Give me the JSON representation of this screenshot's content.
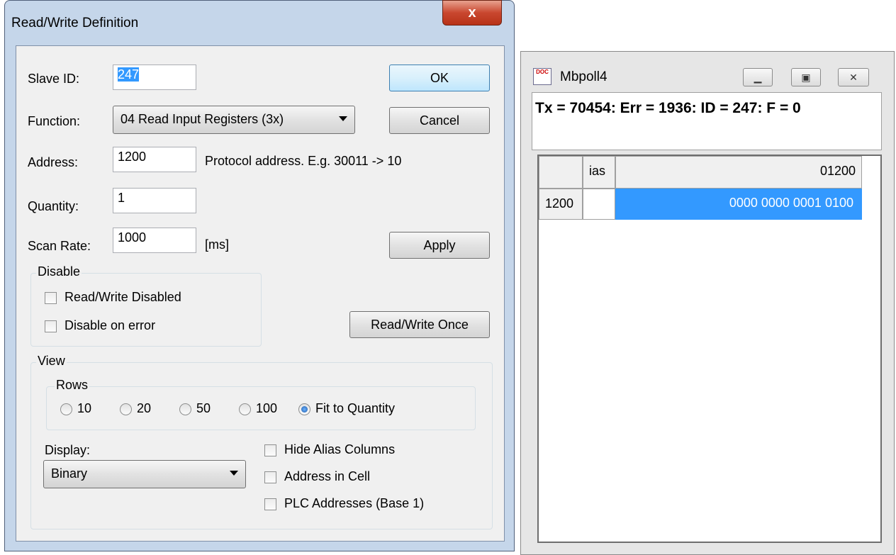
{
  "dialog": {
    "title": "Read/Write Definition",
    "close_label": "x",
    "slave_id": {
      "label": "Slave ID:",
      "value": "247"
    },
    "function": {
      "label": "Function:",
      "value": "04 Read Input Registers (3x)"
    },
    "address": {
      "label": "Address:",
      "value": "1200",
      "hint": "Protocol address. E.g. 30011 -> 10"
    },
    "quantity": {
      "label": "Quantity:",
      "value": "1"
    },
    "scan_rate": {
      "label": "Scan Rate:",
      "value": "1000",
      "unit": "[ms]"
    },
    "buttons": {
      "ok": "OK",
      "cancel": "Cancel",
      "apply": "Apply",
      "read_write_once": "Read/Write Once"
    },
    "disable": {
      "title": "Disable",
      "read_write_disabled": {
        "label": "Read/Write Disabled",
        "checked": false
      },
      "disable_on_error": {
        "label": "Disable on error",
        "checked": false
      }
    },
    "view": {
      "title": "View",
      "rows": {
        "title": "Rows",
        "options": [
          "10",
          "20",
          "50",
          "100",
          "Fit to Quantity"
        ],
        "selected": "Fit to Quantity"
      },
      "display": {
        "label": "Display:",
        "value": "Binary"
      },
      "hide_alias_columns": {
        "label": "Hide Alias Columns",
        "checked": false
      },
      "address_in_cell": {
        "label": "Address in Cell",
        "checked": false
      },
      "plc_addresses": {
        "label": "PLC Addresses (Base 1)",
        "checked": false
      }
    }
  },
  "mbpoll": {
    "icon_text": "DOC",
    "title": "Mbpoll4",
    "status_line": "Tx = 70454: Err = 1936: ID = 247: F = 0",
    "grid": {
      "alias_header": "ias",
      "value_header": "01200",
      "row_address": "1200",
      "row_alias": "",
      "row_value": "0000 0000 0001 0100"
    },
    "colors": {
      "selected_cell": "#3399ff"
    }
  }
}
